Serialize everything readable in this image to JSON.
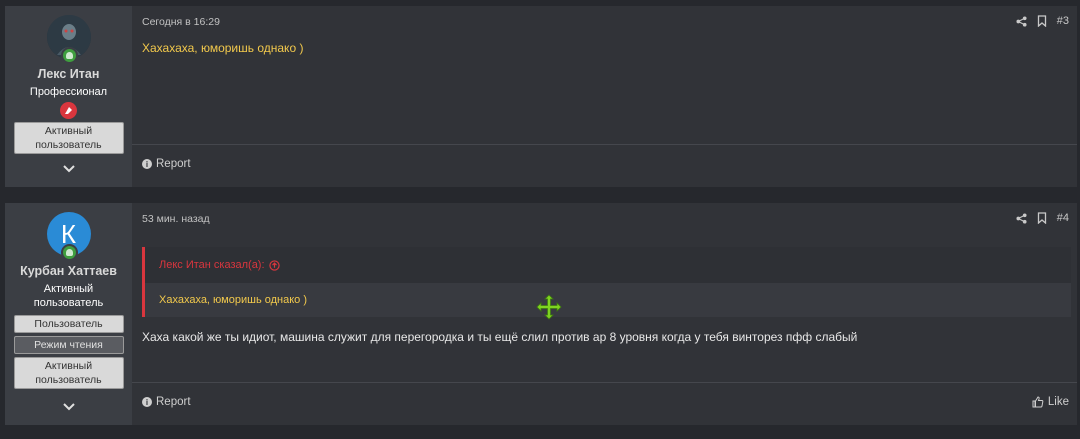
{
  "posts": [
    {
      "user": {
        "name": "Лекс Итан",
        "title": "Профессионал",
        "banners": [
          "Активный пользователь"
        ]
      },
      "date": "Сегодня в 16:29",
      "number": "#3",
      "text": "Хахахаха, юморишь однако )",
      "footer": {
        "report": "Report"
      }
    },
    {
      "user": {
        "name": "Курбан Хаттаев",
        "avatar_letter": "К",
        "title": "Активный пользователь",
        "banners": [
          "Пользователь",
          "Режим чтения",
          "Активный пользователь"
        ]
      },
      "date": "53 мин. назад",
      "number": "#4",
      "quote": {
        "author": "Лекс Итан сказал(а):",
        "text": "Хахахаха, юморишь однако )"
      },
      "text": "Хаха какой же ты идиот, машина служит для перегородка и ты ещё слил против ар 8 уровня когда у тебя винторез пфф слабый",
      "footer": {
        "report": "Report",
        "like": "Like"
      }
    }
  ],
  "colors": {
    "accent_yellow": "#f2c94c",
    "quote_red": "#d9363e",
    "online_green": "#3f9e3f",
    "avatar_blue": "#2a8bd6",
    "cursor_green": "#7ed321"
  },
  "icons": {
    "share": "share-icon",
    "bookmark": "bookmark-icon",
    "expand": "chevron-down-icon",
    "report": "info-icon",
    "like": "thumbs-up-icon",
    "cursor": "move-cursor-icon"
  }
}
